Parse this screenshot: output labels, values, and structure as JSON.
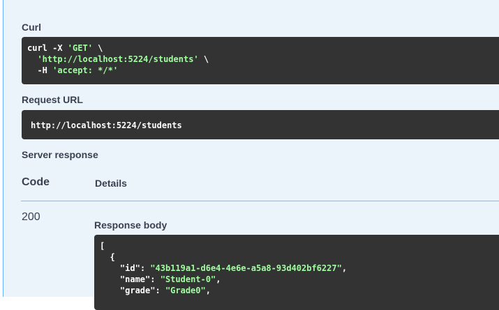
{
  "curl": {
    "label": "Curl",
    "line1_cmd": "curl -X ",
    "line1_method": "'GET'",
    "line1_tail": " \\",
    "line2_url": "  'http://localhost:5224/students'",
    "line2_tail": " \\",
    "line3_cmd": "  -H ",
    "line3_header": "'accept: */*'"
  },
  "request_url": {
    "label": "Request URL",
    "value": "http://localhost:5224/students"
  },
  "server_response": {
    "label": "Server response",
    "col_code": "Code",
    "col_details": "Details"
  },
  "response": {
    "code": "200",
    "body_label": "Response body",
    "lines": [
      {
        "plain": "[",
        "key": "",
        "val": "",
        "tail": ""
      },
      {
        "plain": "  {",
        "key": "",
        "val": "",
        "tail": ""
      },
      {
        "plain": "    ",
        "key": "\"id\"",
        "val": "\"43b119a1-d6e4-4e6e-a5a8-93d402bf6227\"",
        "tail": ","
      },
      {
        "plain": "    ",
        "key": "\"name\"",
        "val": "\"Student-0\"",
        "tail": ","
      },
      {
        "plain": "    ",
        "key": "\"grade\"",
        "val": "\"Grade0\"",
        "tail": ","
      }
    ]
  },
  "colors": {
    "background": "#ebf3fb",
    "code_bg": "#333333",
    "string": "#a2fca2",
    "accent": "#61affe"
  }
}
